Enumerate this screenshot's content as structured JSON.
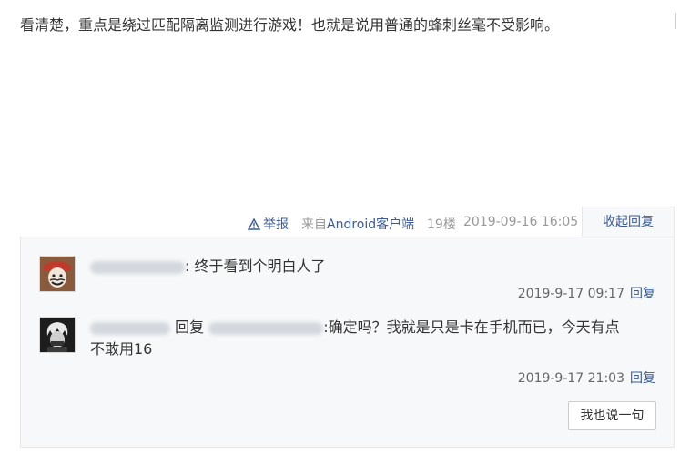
{
  "post": {
    "text": "看清楚，重点是绕过匹配隔离监测进行游戏！也就是说用普通的蜂刺丝毫不受影响。"
  },
  "meta": {
    "report_label": "举报",
    "source_prefix": "来自",
    "source_device": "Android客户端",
    "floor": "19楼",
    "time": "2019-09-16 16:05",
    "collapse_label": "收起回复"
  },
  "replies": [
    {
      "avatar": "pirate-avatar",
      "text": ": 终于看到个明白人了",
      "time": "2019-9-17 09:17",
      "reply_label": "回复"
    },
    {
      "avatar": "white-hair-avatar",
      "reply_word": "回复",
      "text_line1": ":确定吗？我就是只是卡在手机而已，今天有点",
      "text_line2": "不敢用16",
      "time": "2019-9-17 21:03",
      "reply_label": "回复"
    }
  ],
  "say_button": "我也说一句",
  "colors": {
    "link": "#3a5a99",
    "muted": "#999999",
    "reply_bg": "#f7f8fa"
  }
}
